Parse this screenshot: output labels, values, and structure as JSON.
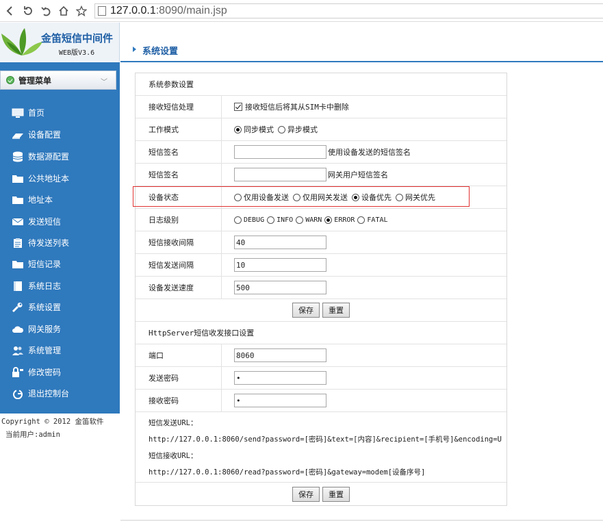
{
  "browser": {
    "url_host": "127.0.0.1",
    "url_rest": ":8090/main.jsp",
    "buttons": [
      "back-icon",
      "reload-icon",
      "undo-icon",
      "home-icon",
      "star-icon"
    ]
  },
  "logo": {
    "title": "金笛短信中间件",
    "version": "WEB版V3.6"
  },
  "sidebar": {
    "menu_title": "管理菜单",
    "items": [
      {
        "label": "首页",
        "icon": "monitor-icon"
      },
      {
        "label": "设备配置",
        "icon": "device-icon"
      },
      {
        "label": "数据源配置",
        "icon": "database-icon"
      },
      {
        "label": "公共地址本",
        "icon": "folder-icon"
      },
      {
        "label": "地址本",
        "icon": "folder-icon"
      },
      {
        "label": "发送短信",
        "icon": "mail-icon"
      },
      {
        "label": "待发送列表",
        "icon": "clipboard-icon"
      },
      {
        "label": "短信记录",
        "icon": "folder-icon"
      },
      {
        "label": "系统日志",
        "icon": "book-icon"
      },
      {
        "label": "系统设置",
        "icon": "wrench-icon"
      },
      {
        "label": "网关服务",
        "icon": "cloud-icon"
      },
      {
        "label": "系统管理",
        "icon": "users-icon"
      },
      {
        "label": "修改密码",
        "icon": "key-icon"
      },
      {
        "label": "退出控制台",
        "icon": "power-icon"
      }
    ],
    "copyright": "Copyright © 2012 金笛软件",
    "current_user": "当前用户:admin"
  },
  "header": {
    "title": "系统设置"
  },
  "form": {
    "section1": "系统参数设置",
    "receive_label": "接收短信处理",
    "receive_checkbox": "接收短信后将其从SIM卡中删除",
    "mode_label": "工作模式",
    "mode_sync": "同步模式",
    "mode_async": "异步模式",
    "sign1_label": "短信签名",
    "sign1_hint": "使用设备发送的短信签名",
    "sign2_label": "短信签名",
    "sign2_hint": "网关用户短信签名",
    "status_label": "设备状态",
    "status_opts": [
      "仅用设备发送",
      "仅用网关发送",
      "设备优先",
      "网关优先"
    ],
    "log_label": "日志级别",
    "log_opts": [
      "DEBUG",
      "INFO",
      "WARN",
      "ERROR",
      "FATAL"
    ],
    "recv_interval_label": "短信接收间隔",
    "recv_interval_value": "40",
    "send_interval_label": "短信发送间隔",
    "send_interval_value": "10",
    "speed_label": "设备发送速度",
    "speed_value": "500",
    "save": "保存",
    "reset": "重置",
    "section2": "HttpServer短信收发接口设置",
    "port_label": "端口",
    "port_value": "8060",
    "send_pwd_label": "发送密码",
    "send_pwd_value": "•",
    "recv_pwd_label": "接收密码",
    "recv_pwd_value": "•",
    "send_url_title": "短信发送URL：",
    "send_url": "http://127.0.0.1:8060/send?password=[密码]&text=[内容]&recipient=[手机号]&encoding=U",
    "recv_url_title": "短信接收URL：",
    "recv_url": "http://127.0.0.1:8060/read?password=[密码]&gateway=modem[设备序号]"
  }
}
